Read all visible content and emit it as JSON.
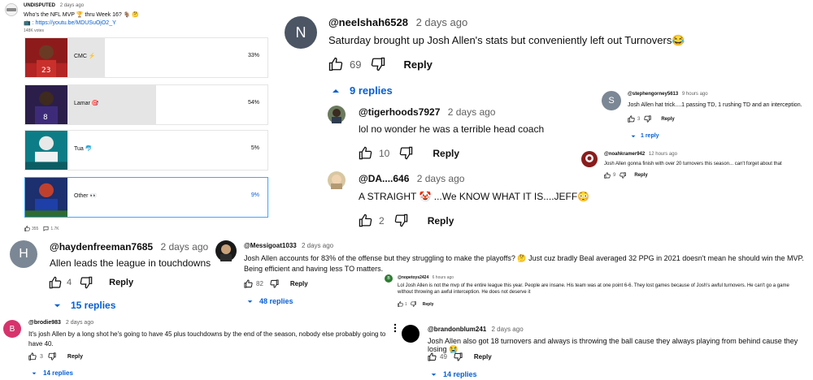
{
  "poll": {
    "channel": "UNDISPUTED",
    "date": "2 days ago",
    "question_line1": "Who's the NFL MVP 🏆 thru Week 16? 🐐 🤔",
    "question_line2": "📺 : https://youtu.be/MDUSuOjO2_Y",
    "votes": "148K votes",
    "options": [
      {
        "label": "CMC ⚡",
        "pct": "33%",
        "fraction": 0.33
      },
      {
        "label": "Lamar 🎯",
        "pct": "54%",
        "fraction": 0.54
      },
      {
        "label": "Tua 🐬",
        "pct": "5%",
        "fraction": 0.05
      },
      {
        "label": "Other 👀",
        "pct": "9%",
        "fraction": 0.09
      }
    ],
    "likes": "355",
    "comments_count": "1.7K"
  },
  "comments": {
    "neelshah": {
      "initial": "N",
      "handle": "@neelshah6528",
      "date": "2 days ago",
      "text": "Saturday brought up Josh Allen's stats but conveniently left out Turnovers😂",
      "likes": "69",
      "reply": "Reply",
      "replies": "9 replies"
    },
    "tigerhoods": {
      "handle": "@tigerhoods7927",
      "date": "2 days ago",
      "text": "lol no wonder he was a terrible head coach",
      "likes": "10",
      "reply": "Reply"
    },
    "da646": {
      "handle": "@DA....646",
      "date": "2 days ago",
      "text": "A STRAIGHT 🤡 ...We KNOW WHAT IT IS....JEFF😳",
      "likes": "2",
      "reply": "Reply"
    },
    "stephen": {
      "initial": "S",
      "handle": "@stephengorney5613",
      "date": "9 hours ago",
      "text": "Josh Allen hat trick....1 passing TD, 1 rushing TD and an interception.",
      "likes": "3",
      "reply": "Reply",
      "replies": "1 reply"
    },
    "noah": {
      "handle": "@noahkramer942",
      "date": "12 hours ago",
      "text": "Josh Allen gonna finish with over 20 turnovers this season... can't forget about that",
      "likes": "9",
      "reply": "Reply"
    },
    "hayden": {
      "initial": "H",
      "handle": "@haydenfreeman7685",
      "date": "2 days ago",
      "text": "Allen leads the league in touchdowns",
      "likes": "4",
      "reply": "Reply",
      "replies": "15 replies"
    },
    "messi": {
      "handle": "@Messigoat1033",
      "date": "2 days ago",
      "text": "Josh Allen accounts for 83% of the offense but they struggling to make the playoffs? 🤔  Just cuz bradly Beal averaged 32 PPG in 2021 doesn't mean he should win the MVP. Being efficient and having less TO matters.",
      "likes": "82",
      "reply": "Reply",
      "replies": "48 replies"
    },
    "nopetoys": {
      "initial": "B",
      "handle": "@nopetoys2424",
      "date": "6 hours ago",
      "text": "Lol Josh Allen is not the mvp of the entire league this year. People are insane. His team was at one point 6-6. They lost games because of Josh's awful turnovers. He can't go a game without throwing an awful interception. He does not deserve it",
      "likes": "1",
      "reply": "Reply"
    },
    "brodie": {
      "initial": "B",
      "handle": "@brodie983",
      "date": "2 days ago",
      "text": "It's josh Allen by a long shot he's going to have 45 plus touchdowns by the end of the season, nobody else probably going to have 40.",
      "likes": "3",
      "reply": "Reply",
      "replies": "14 replies"
    },
    "brandon": {
      "handle": "@brandonblum241",
      "date": "2 days ago",
      "text": "Josh Allen also got 18 turnovers and always is throwing the ball cause they always playing from behind cause they losing 😭",
      "likes": "49",
      "reply": "Reply",
      "replies": "14 replies"
    }
  },
  "colors": {
    "link": "#065fd4",
    "meta": "#606060",
    "text": "#0f0f0f",
    "poll_fill": "#e5e5e5",
    "poll_selected": "#cfe6fb"
  }
}
